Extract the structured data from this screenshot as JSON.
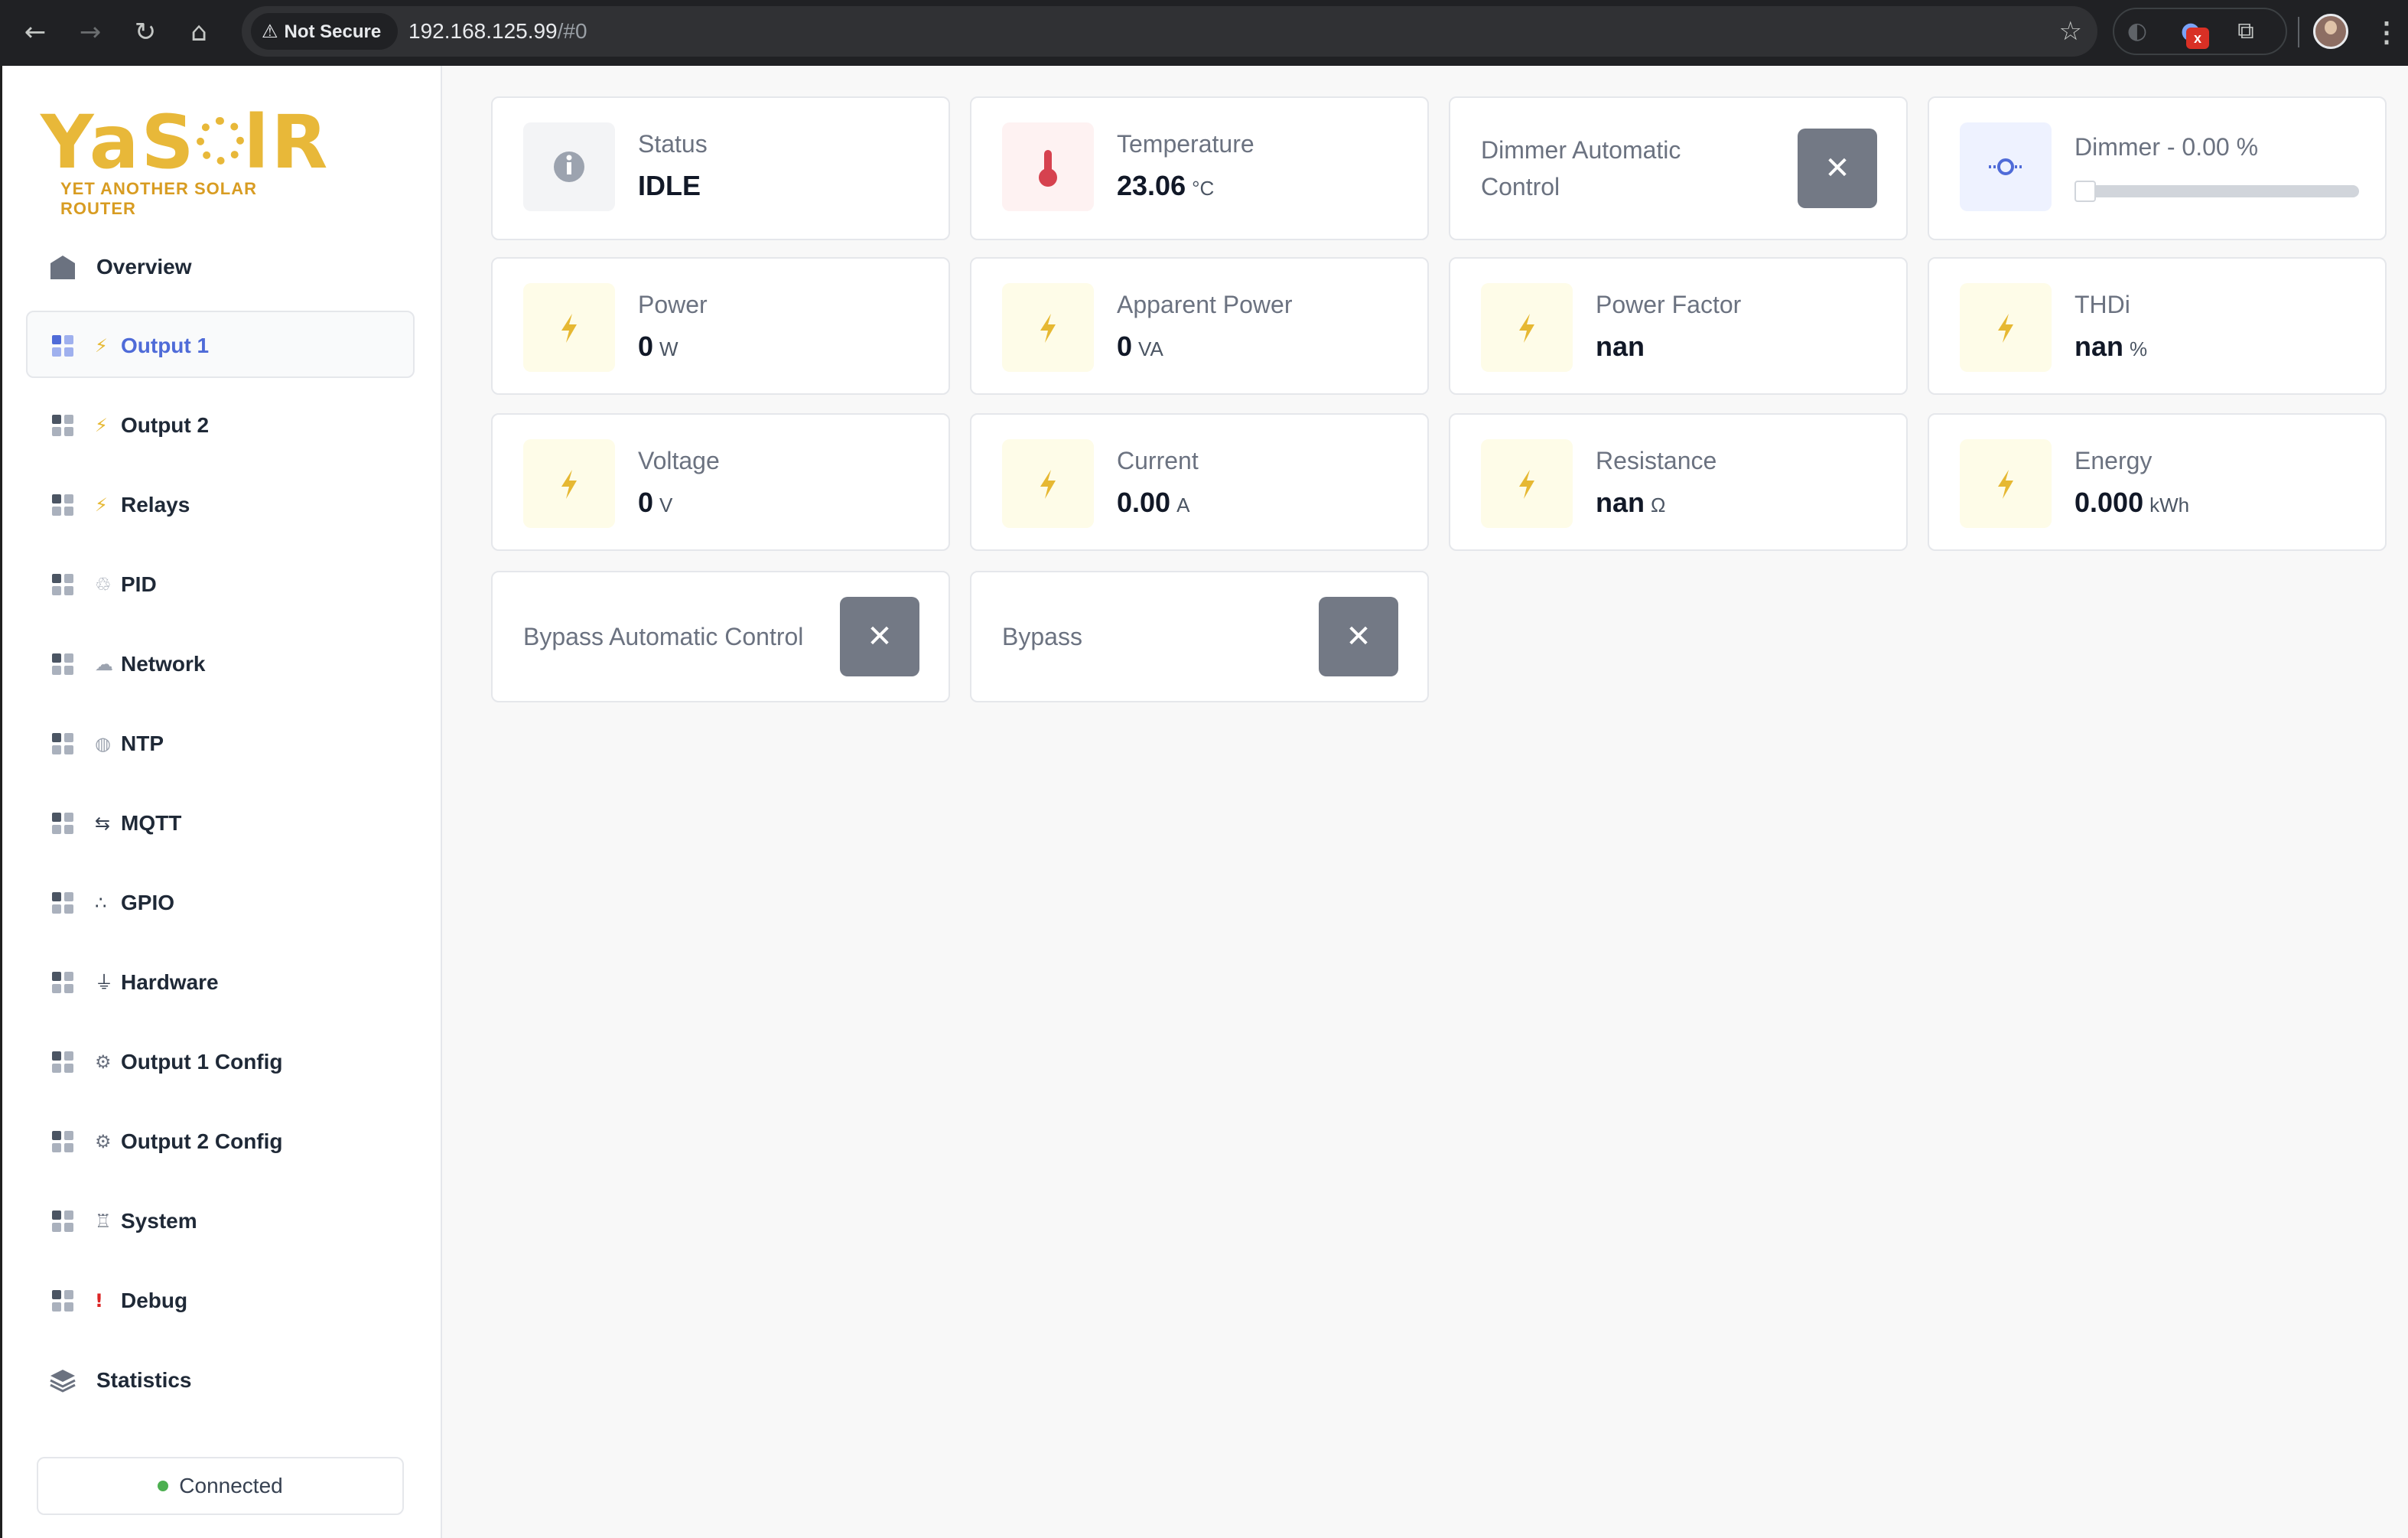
{
  "browser": {
    "security_label": "Not Secure",
    "url_host": "192.168.125.99",
    "url_path": "/#0",
    "extension_badge": "x"
  },
  "sidebar": {
    "logo_text": "YaSolR",
    "logo_tagline": "YET ANOTHER SOLAR ROUTER",
    "overview": "Overview",
    "items": [
      {
        "emoji": "⚡",
        "label": "Output 1"
      },
      {
        "emoji": "⚡",
        "label": "Output 2"
      },
      {
        "emoji": "⚡",
        "label": "Relays"
      },
      {
        "emoji": "♲",
        "label": "PID"
      },
      {
        "emoji": "☁",
        "label": "Network"
      },
      {
        "emoji": "◍",
        "label": "NTP"
      },
      {
        "emoji": "⇆",
        "label": "MQTT"
      },
      {
        "emoji": "∴",
        "label": "GPIO"
      },
      {
        "emoji": "⏚",
        "label": "Hardware"
      },
      {
        "emoji": "⚙",
        "label": "Output 1 Config"
      },
      {
        "emoji": "⚙",
        "label": "Output 2 Config"
      },
      {
        "emoji": "♖",
        "label": "System"
      },
      {
        "emoji": "!",
        "label": "Debug"
      }
    ],
    "statistics": "Statistics",
    "status": "Connected"
  },
  "cards": {
    "status": {
      "title": "Status",
      "value": "IDLE"
    },
    "temperature": {
      "title": "Temperature",
      "value": "23.06",
      "unit": "°C"
    },
    "dimmer_auto": {
      "title": "Dimmer Automatic Control",
      "button": "✕"
    },
    "dimmer": {
      "title": "Dimmer - 0.00 %",
      "level": 0
    },
    "power": {
      "title": "Power",
      "value": "0",
      "unit": "W"
    },
    "apparent_power": {
      "title": "Apparent Power",
      "value": "0",
      "unit": "VA"
    },
    "power_factor": {
      "title": "Power Factor",
      "value": "nan",
      "unit": ""
    },
    "thdi": {
      "title": "THDi",
      "value": "nan",
      "unit": "%"
    },
    "voltage": {
      "title": "Voltage",
      "value": "0",
      "unit": "V"
    },
    "current": {
      "title": "Current",
      "value": "0.00",
      "unit": "A"
    },
    "resistance": {
      "title": "Resistance",
      "value": "nan",
      "unit": "Ω"
    },
    "energy": {
      "title": "Energy",
      "value": "0.000",
      "unit": "kWh"
    },
    "bypass_auto": {
      "title": "Bypass Automatic Control",
      "button": "✕"
    },
    "bypass": {
      "title": "Bypass",
      "button": "✕"
    }
  },
  "colors": {
    "accent": "#4f6bd8",
    "bolt": "#e6b832",
    "thermo": "#d6424f",
    "toggle_off": "#737985",
    "connected": "#4caf50"
  }
}
